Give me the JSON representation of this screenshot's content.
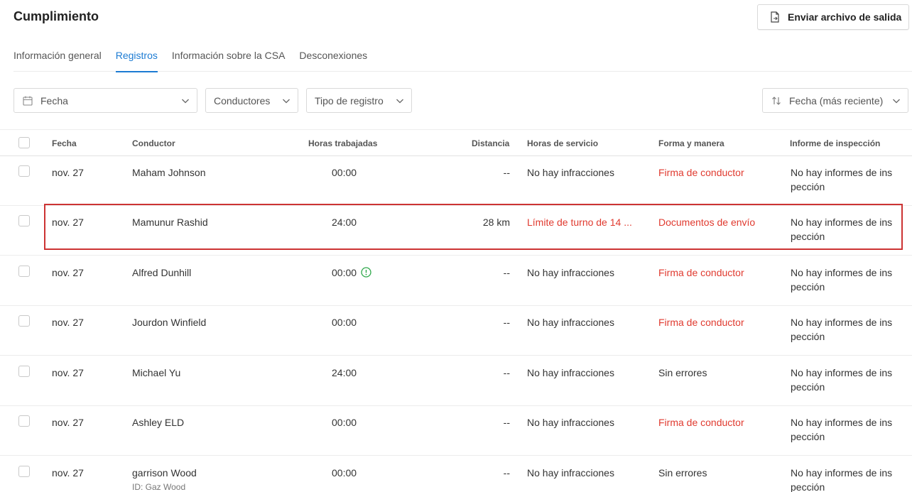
{
  "page": {
    "title": "Cumplimiento"
  },
  "export_button": {
    "label": "Enviar archivo de salida",
    "icon": "file-export-icon"
  },
  "tabs": [
    {
      "label": "Información general",
      "active": false
    },
    {
      "label": "Registros",
      "active": true
    },
    {
      "label": "Información sobre la CSA",
      "active": false
    },
    {
      "label": "Desconexiones",
      "active": false
    }
  ],
  "filters": {
    "date": {
      "label": "Fecha",
      "icon": "calendar-icon"
    },
    "drivers": {
      "label": "Conductores"
    },
    "log_type": {
      "label": "Tipo de registro"
    },
    "sort": {
      "label": "Fecha (más reciente)",
      "icon": "sort-icon"
    }
  },
  "table": {
    "columns": {
      "date": "Fecha",
      "driver": "Conductor",
      "hours": "Horas trabajadas",
      "distance": "Distancia",
      "hos": "Horas de servicio",
      "form": "Forma y manera",
      "inspection": "Informe de inspección"
    },
    "rows": [
      {
        "date": "nov. 27",
        "driver": "Maham Johnson",
        "driver_sub": "",
        "hours": "00:00",
        "distance": "--",
        "hos": "No hay infracciones",
        "form": "Firma de conductor",
        "inspection_line1": "No hay informes de ins",
        "inspection_line2": "pección"
      },
      {
        "date": "nov. 27",
        "driver": "Mamunur Rashid",
        "driver_sub": "",
        "hours": "24:00",
        "distance": "28 km",
        "hos": "Límite de turno de 14 ...",
        "form": "Documentos de envío",
        "inspection_line1": "No hay informes de ins",
        "inspection_line2": "pección"
      },
      {
        "date": "nov. 27",
        "driver": "Alfred Dunhill",
        "driver_sub": "",
        "hours": "00:00",
        "distance": "--",
        "hos": "No hay infracciones",
        "form": "Firma de conductor",
        "inspection_line1": "No hay informes de ins",
        "inspection_line2": "pección"
      },
      {
        "date": "nov. 27",
        "driver": "Jourdon Winfield",
        "driver_sub": "",
        "hours": "00:00",
        "distance": "--",
        "hos": "No hay infracciones",
        "form": "Firma de conductor",
        "inspection_line1": "No hay informes de ins",
        "inspection_line2": "pección"
      },
      {
        "date": "nov. 27",
        "driver": "Michael Yu",
        "driver_sub": "",
        "hours": "24:00",
        "distance": "--",
        "hos": "No hay infracciones",
        "form": "Sin errores",
        "inspection_line1": "No hay informes de ins",
        "inspection_line2": "pección"
      },
      {
        "date": "nov. 27",
        "driver": "Ashley ELD",
        "driver_sub": "",
        "hours": "00:00",
        "distance": "--",
        "hos": "No hay infracciones",
        "form": "Firma de conductor",
        "inspection_line1": "No hay informes de ins",
        "inspection_line2": "pección"
      },
      {
        "date": "nov. 27",
        "driver": "garrison Wood",
        "driver_sub": "ID: Gaz Wood",
        "hours": "00:00",
        "distance": "--",
        "hos": "No hay infracciones",
        "form": "Sin errores",
        "inspection_line1": "No hay informes de ins",
        "inspection_line2": "pección"
      }
    ]
  },
  "colors": {
    "accent": "#1c7bd3",
    "error": "#e03a2f",
    "success_icon": "#2ea84a",
    "highlight": "#cc3333"
  }
}
